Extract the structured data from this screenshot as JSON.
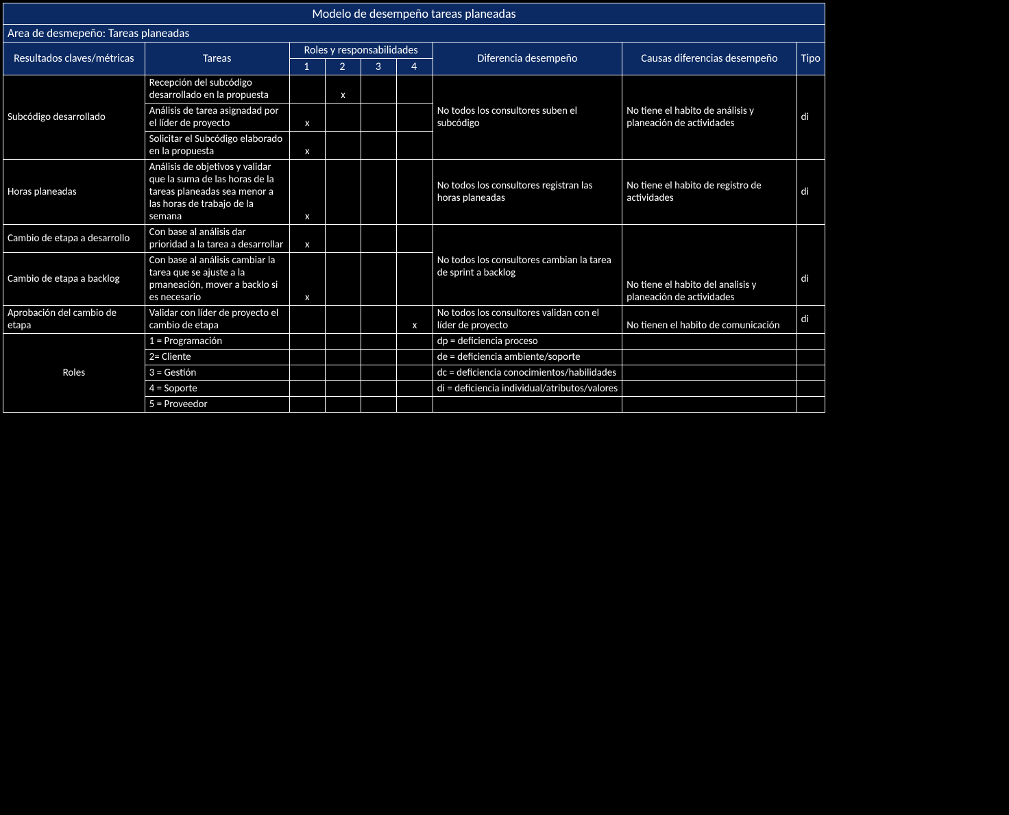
{
  "title": "Modelo de desempeño tareas planeadas",
  "area": "Area de desmepeño: Tareas planeadas",
  "headers": {
    "resultados": "Resultados claves/métricas",
    "tareas": "Tareas",
    "roles": "Roles y responsabilidades",
    "diferencia": "Diferencia desempeño",
    "causas": "Causas diferencias desempeño",
    "tipo": "Tipo",
    "r1": "1",
    "r2": "2",
    "r3": "3",
    "r4": "4"
  },
  "rows": {
    "r1": {
      "resultado": "Subcódigo desarrollado",
      "tarea": "Recepción del subcódigo desarrollado en la propuesta",
      "marks": [
        "",
        "x",
        "",
        ""
      ],
      "diferencia": "No todos los consultores suben el subcódigo",
      "causas": "No tiene el habito de análisis y planeación  de actividades",
      "tipo": "di"
    },
    "r2": {
      "tarea": "Análisis de tarea asignadad por el líder de proyecto",
      "marks": [
        "x",
        "",
        "",
        ""
      ]
    },
    "r3": {
      "tarea": "Solicitar el Subcódigo elaborado en la propuesta",
      "marks": [
        "x",
        "",
        "",
        ""
      ]
    },
    "r4": {
      "resultado": "Horas planeadas",
      "tarea": "Análisis de objetivos y validar que la suma de las horas de la tareas planeadas sea menor a las horas de trabajo de la semana",
      "marks": [
        "x",
        "",
        "",
        ""
      ],
      "diferencia": "No todos los consultores registran las horas planeadas",
      "causas": "No tiene el habito de registro de actividades",
      "tipo": "di"
    },
    "r5": {
      "resultado": "Cambio de etapa a desarrollo",
      "tarea": "Con base al análisis dar prioridad a la tarea a desarrollar",
      "marks": [
        "x",
        "",
        "",
        ""
      ],
      "diferencia": "",
      "causas": "",
      "tipo": ""
    },
    "r6": {
      "resultado": "Cambio de etapa a backlog",
      "tarea": "Con base al análisis cambiar la tarea que se ajuste a la pmaneación, mover a backlo si es necesario",
      "marks": [
        "x",
        "",
        "",
        ""
      ],
      "diferencia": "No todos los consultores cambian la tarea de sprint a backlog",
      "causas": "No tiene el habito del analisis y planeación de actividades",
      "tipo": "di"
    },
    "r7": {
      "resultado": "Aprobación del cambio de etapa",
      "tarea": "Validar con líder de proyecto el cambio de etapa",
      "marks": [
        "",
        "",
        "",
        "x"
      ],
      "diferencia": "No todos los consultores validan con el líder de proyecto",
      "causas": "No tienen el habito de comunicación",
      "tipo": "di"
    }
  },
  "legend": {
    "roles_label": "Roles",
    "roles": {
      "l1": "1 = Programación",
      "l2": "2= Cliente",
      "l3": "3 = Gestión",
      "l4": "4 = Soporte",
      "l5": "5 = Proveedor"
    },
    "defs": {
      "d1": "dp = deficiencia proceso",
      "d2": "de = deficiencia ambiente/soporte",
      "d3": "dc = deficiencia conocimientos/habilidades",
      "d4": "di = deficiencia individual/atributos/valores",
      "d5": ""
    }
  }
}
